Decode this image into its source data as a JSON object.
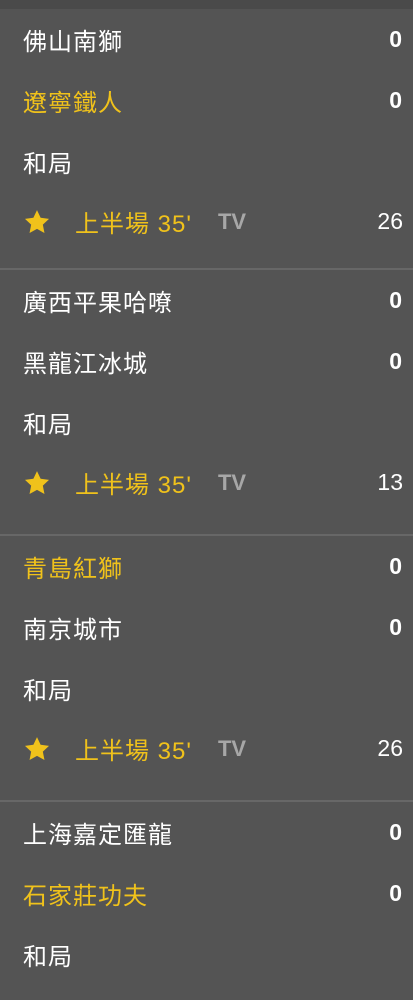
{
  "matches": [
    {
      "home": {
        "name": "佛山南獅",
        "score": "0",
        "highlight": false
      },
      "away": {
        "name": "遼寧鐵人",
        "score": "0",
        "highlight": true
      },
      "result_label": "和局",
      "period": "上半場 35'",
      "tv": "TV",
      "count": "26"
    },
    {
      "home": {
        "name": "廣西平果哈嘹",
        "score": "0",
        "highlight": false
      },
      "away": {
        "name": "黑龍江冰城",
        "score": "0",
        "highlight": false
      },
      "result_label": "和局",
      "period": "上半場 35'",
      "tv": "TV",
      "count": "13"
    },
    {
      "home": {
        "name": "青島紅獅",
        "score": "0",
        "highlight": true
      },
      "away": {
        "name": "南京城市",
        "score": "0",
        "highlight": false
      },
      "result_label": "和局",
      "period": "上半場 35'",
      "tv": "TV",
      "count": "26"
    },
    {
      "home": {
        "name": "上海嘉定匯龍",
        "score": "0",
        "highlight": false
      },
      "away": {
        "name": "石家莊功夫",
        "score": "0",
        "highlight": true
      },
      "result_label": "和局"
    }
  ],
  "colors": {
    "background": "#545454",
    "highlight": "#f0c21b",
    "text": "#ffffff",
    "muted": "#a7a7a7",
    "divider": "#676767"
  },
  "icons": {
    "favorite": "star-icon"
  }
}
